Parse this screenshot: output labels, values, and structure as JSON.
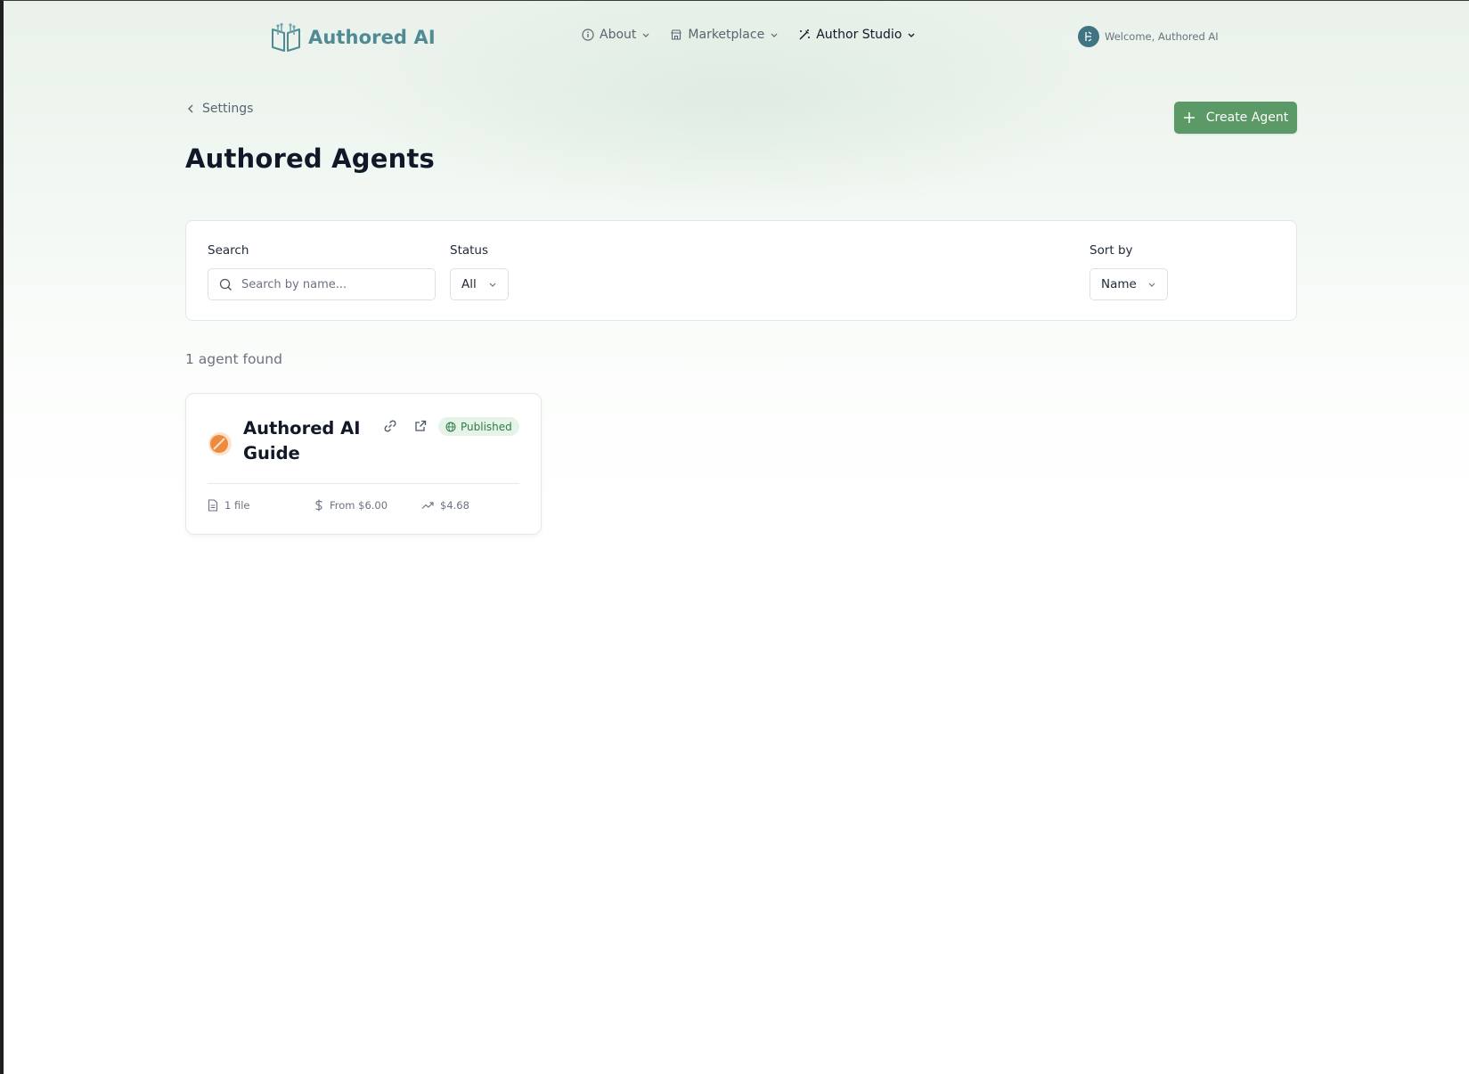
{
  "header": {
    "brand": "Authored AI",
    "nav": [
      {
        "label": "About",
        "icon": "info-icon"
      },
      {
        "label": "Marketplace",
        "icon": "store-icon"
      },
      {
        "label": "Author Studio",
        "icon": "magic-wand-icon"
      }
    ],
    "welcome": "Welcome, Authored AI"
  },
  "page": {
    "back_label": "Settings",
    "title": "Authored Agents",
    "create_label": "Create Agent"
  },
  "filters": {
    "search_label": "Search",
    "search_placeholder": "Search by name...",
    "search_value": "",
    "status_label": "Status",
    "status_value": "All",
    "sort_label": "Sort by",
    "sort_value": "Name"
  },
  "results": {
    "count_text": "1 agent found",
    "agents": [
      {
        "name": "Authored AI Guide",
        "status": "Published",
        "files": "1 file",
        "price": "From $6.00",
        "earnings": "$4.68"
      }
    ]
  },
  "colors": {
    "brand": "#4f8a95",
    "primary_button": "#5b9966",
    "published_badge_bg": "#e6f3e8",
    "published_badge_text": "#2e7d45",
    "agent_icon": "#ef8a3c"
  }
}
